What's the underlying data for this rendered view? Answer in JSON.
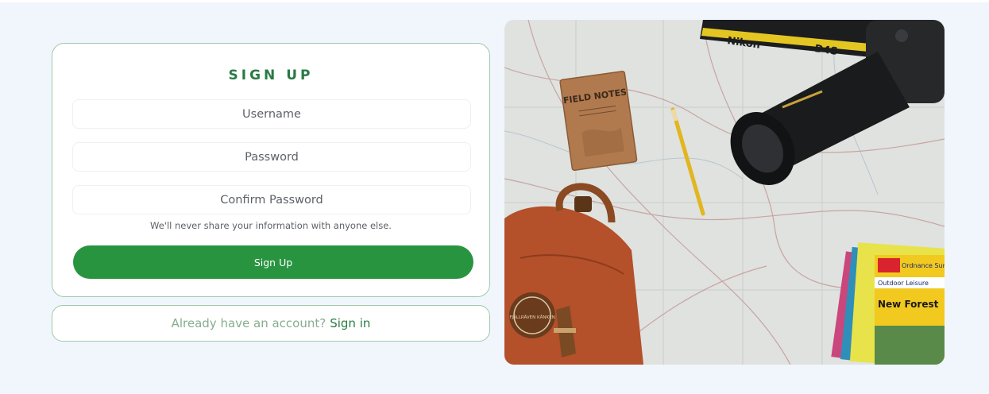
{
  "form": {
    "title": "SIGN UP",
    "username_placeholder": "Username",
    "password_placeholder": "Password",
    "confirm_placeholder": "Confirm Password",
    "hint": "We'll never share your information with anyone else.",
    "submit_label": "Sign Up"
  },
  "signin": {
    "question": "Already have an account?",
    "link_label": "Sign in"
  },
  "photo": {
    "notebook_text": "FIELD NOTES",
    "strap_brand": "Nikon",
    "strap_model": "D4S",
    "backpack_patch": "FJÄLLRÄVEN KÅNKEN",
    "map_brand": "Ordnance Survey",
    "map_series": "Outdoor Leisure",
    "map_title": "New Forest"
  },
  "colors": {
    "accent": "#289440",
    "title_green": "#2a7a44",
    "border": "#9fcaa9",
    "page_bg": "#f0f6fc"
  }
}
